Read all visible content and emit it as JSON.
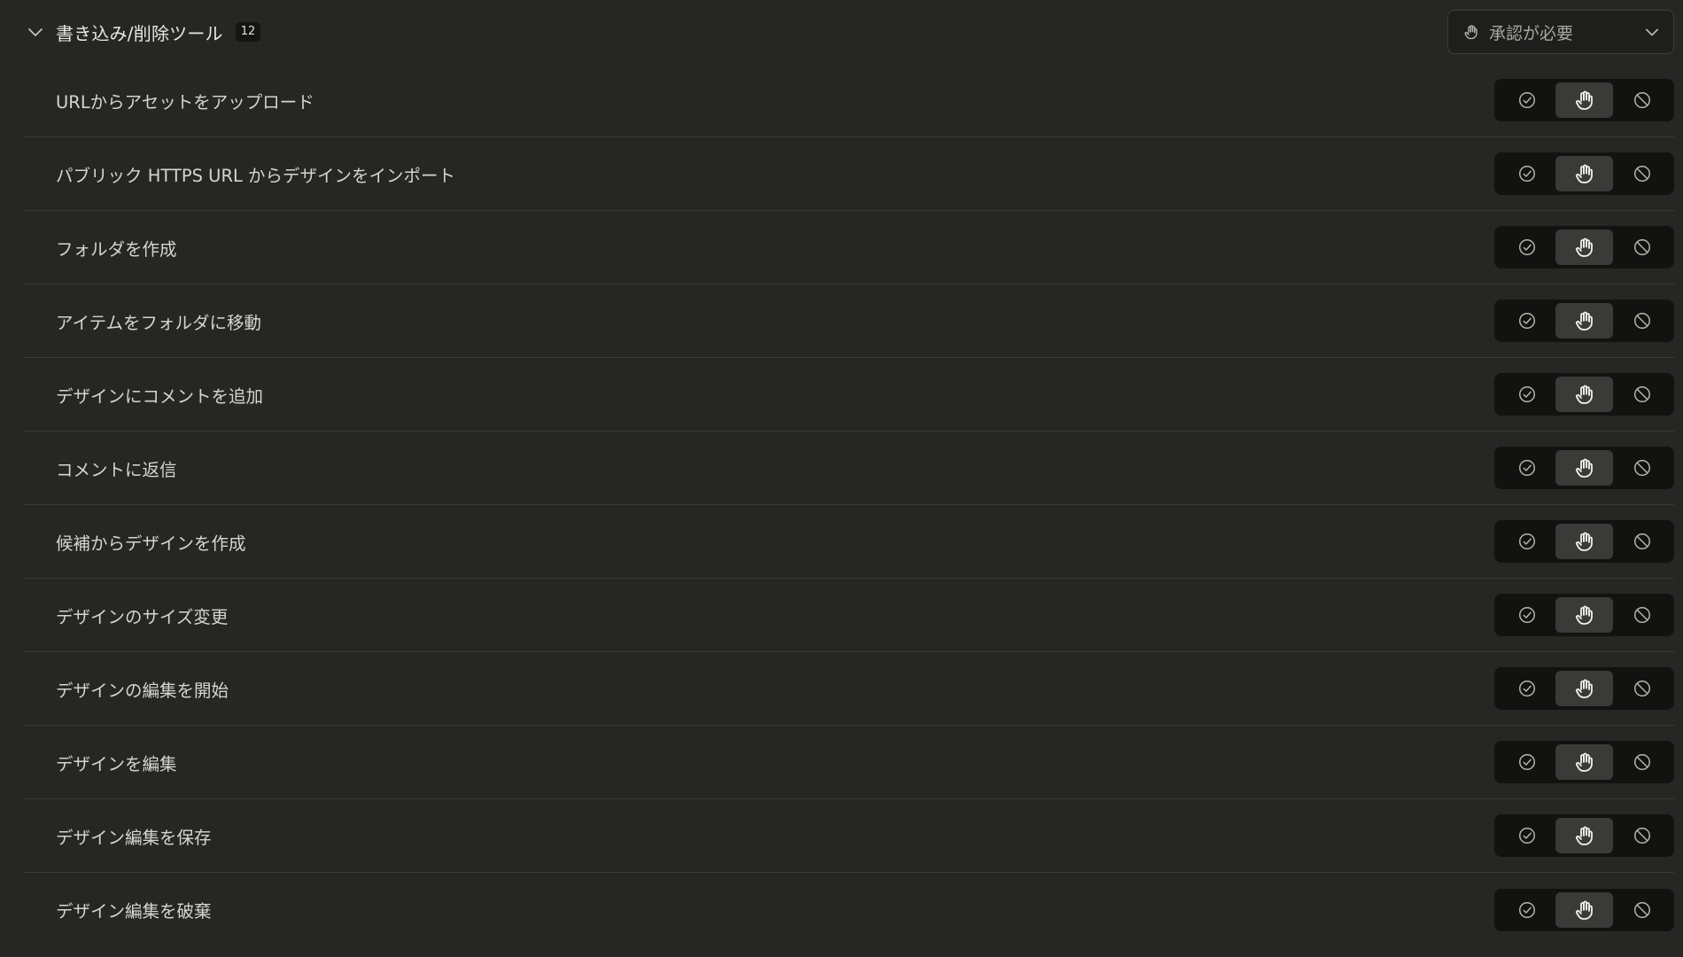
{
  "section": {
    "title": "書き込み/削除ツール",
    "count": "12",
    "approval": {
      "label": "承認が必要",
      "icon": "hand-icon"
    },
    "collapse_icon": "chevron-down-icon"
  },
  "options": [
    {
      "name": "always-allow",
      "icon": "check-circle-icon"
    },
    {
      "name": "needs-approval",
      "icon": "hand-icon"
    },
    {
      "name": "block",
      "icon": "block-icon"
    }
  ],
  "tools": [
    {
      "label": "URLからアセットをアップロード",
      "selected": "needs-approval"
    },
    {
      "label": "パブリック HTTPS URL からデザインをインポート",
      "selected": "needs-approval"
    },
    {
      "label": "フォルダを作成",
      "selected": "needs-approval"
    },
    {
      "label": "アイテムをフォルダに移動",
      "selected": "needs-approval"
    },
    {
      "label": "デザインにコメントを追加",
      "selected": "needs-approval"
    },
    {
      "label": "コメントに返信",
      "selected": "needs-approval"
    },
    {
      "label": "候補からデザインを作成",
      "selected": "needs-approval"
    },
    {
      "label": "デザインのサイズ変更",
      "selected": "needs-approval"
    },
    {
      "label": "デザインの編集を開始",
      "selected": "needs-approval"
    },
    {
      "label": "デザインを編集",
      "selected": "needs-approval"
    },
    {
      "label": "デザイン編集を保存",
      "selected": "needs-approval"
    },
    {
      "label": "デザイン編集を破棄",
      "selected": "needs-approval"
    }
  ],
  "colors": {
    "background": "#262624",
    "segment_bg": "#121211",
    "segment_active": "#3a3a38",
    "divider": "#3a3a37",
    "text": "#d6d4cd",
    "icon": "#b8b6ae",
    "icon_active": "#f2f0ea"
  }
}
